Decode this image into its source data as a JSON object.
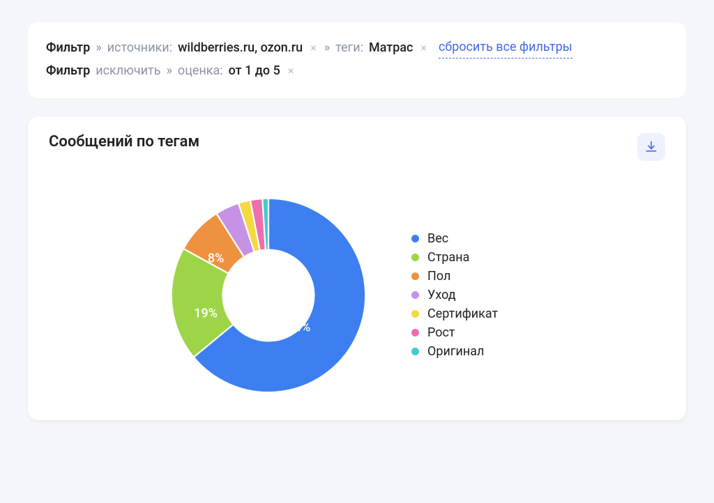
{
  "filters": {
    "include": {
      "title": "Фильтр",
      "sources_label": "источники:",
      "sources_value": "wildberries.ru, ozon.ru",
      "tags_label": "теги:",
      "tags_value": "Матрас"
    },
    "exclude": {
      "title": "Фильтр",
      "suffix": "исключить",
      "rating_label": "оценка:",
      "rating_value": "от 1 до 5"
    },
    "reset_label": "сбросить все фильтры",
    "arrow": "»",
    "x": "×"
  },
  "chart": {
    "title": "Сообщений по тегам",
    "labels": {
      "pct64": "64%",
      "pct19": "19%",
      "pct8": "8%"
    },
    "legend": [
      {
        "name": "Вес",
        "color": "#3d7ff0"
      },
      {
        "name": "Страна",
        "color": "#9ed548"
      },
      {
        "name": "Пол",
        "color": "#ef9240"
      },
      {
        "name": "Уход",
        "color": "#c592e6"
      },
      {
        "name": "Сертификат",
        "color": "#f4d93f"
      },
      {
        "name": "Рост",
        "color": "#ee6fae"
      },
      {
        "name": "Оригинал",
        "color": "#40cdcd"
      }
    ]
  },
  "chart_data": {
    "type": "pie",
    "title": "Сообщений по тегам",
    "categories": [
      "Вес",
      "Страна",
      "Пол",
      "Уход",
      "Сертификат",
      "Рост",
      "Оригинал"
    ],
    "values": [
      64,
      19,
      8,
      4,
      2,
      2,
      1
    ],
    "series_colors": [
      "#3d7ff0",
      "#9ed548",
      "#ef9240",
      "#c592e6",
      "#f4d93f",
      "#ee6fae",
      "#40cdcd"
    ],
    "labeled_slices": {
      "Вес": "64%",
      "Страна": "19%",
      "Пол": "8%"
    },
    "donut_hole_ratio": 0.47
  }
}
